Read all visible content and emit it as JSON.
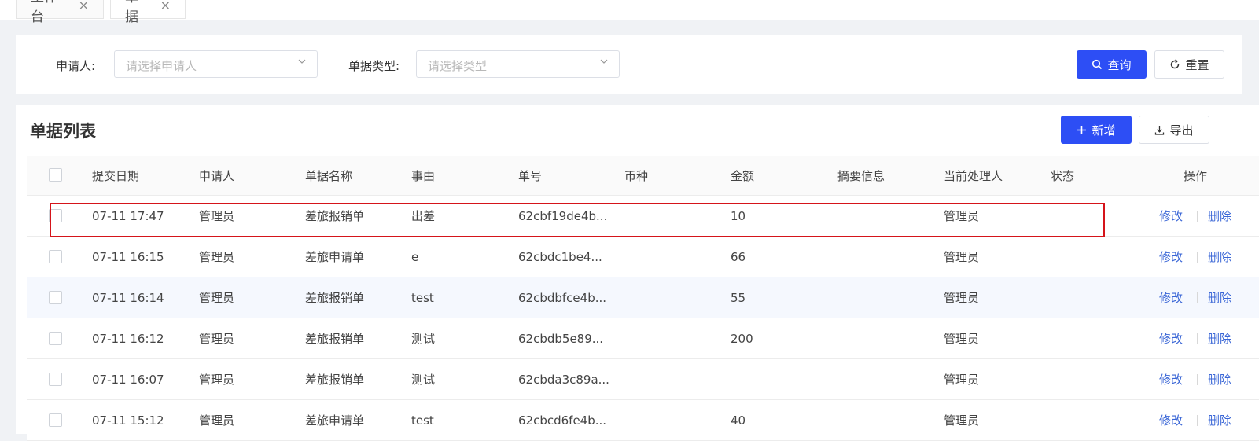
{
  "tabs": [
    {
      "label": "工作台",
      "close": "×"
    },
    {
      "label": "单据",
      "close": "×"
    }
  ],
  "filters": {
    "applicant_label": "申请人:",
    "applicant_placeholder": "请选择申请人",
    "doctype_label": "单据类型:",
    "doctype_placeholder": "请选择类型"
  },
  "buttons": {
    "search": "查询",
    "reset": "重置",
    "add": "新增",
    "export": "导出"
  },
  "list_title": "单据列表",
  "columns": [
    "提交日期",
    "申请人",
    "单据名称",
    "事由",
    "单号",
    "币种",
    "金额",
    "摘要信息",
    "当前处理人",
    "状态",
    "操作"
  ],
  "rows": [
    {
      "date": "07-11 17:47",
      "applicant": "管理员",
      "name": "差旅报销单",
      "reason": "出差",
      "number": "62cbf19de4b...",
      "currency": "",
      "amount": "10",
      "summary": "",
      "handler": "管理员",
      "status": "",
      "edit": "修改",
      "delete": "删除"
    },
    {
      "date": "07-11 16:15",
      "applicant": "管理员",
      "name": "差旅申请单",
      "reason": "e",
      "number": "62cbdc1be4...",
      "currency": "",
      "amount": "66",
      "summary": "",
      "handler": "管理员",
      "status": "",
      "edit": "修改",
      "delete": "删除"
    },
    {
      "date": "07-11 16:14",
      "applicant": "管理员",
      "name": "差旅报销单",
      "reason": "test",
      "number": "62cbdbfce4b...",
      "currency": "",
      "amount": "55",
      "summary": "",
      "handler": "管理员",
      "status": "",
      "edit": "修改",
      "delete": "删除"
    },
    {
      "date": "07-11 16:12",
      "applicant": "管理员",
      "name": "差旅报销单",
      "reason": "测试",
      "number": "62cbdb5e89...",
      "currency": "",
      "amount": "200",
      "summary": "",
      "handler": "管理员",
      "status": "",
      "edit": "修改",
      "delete": "删除"
    },
    {
      "date": "07-11 16:07",
      "applicant": "管理员",
      "name": "差旅报销单",
      "reason": "测试",
      "number": "62cbda3c89a...",
      "currency": "",
      "amount": "",
      "summary": "",
      "handler": "管理员",
      "status": "",
      "edit": "修改",
      "delete": "删除"
    },
    {
      "date": "07-11 15:12",
      "applicant": "管理员",
      "name": "差旅申请单",
      "reason": "test",
      "number": "62cbcd6fe4b...",
      "currency": "",
      "amount": "40",
      "summary": "",
      "handler": "管理员",
      "status": "",
      "edit": "修改",
      "delete": "删除"
    }
  ],
  "colors": {
    "primary": "#2d4ef5",
    "link": "#3a66d6",
    "highlight_border": "#d5141a"
  }
}
